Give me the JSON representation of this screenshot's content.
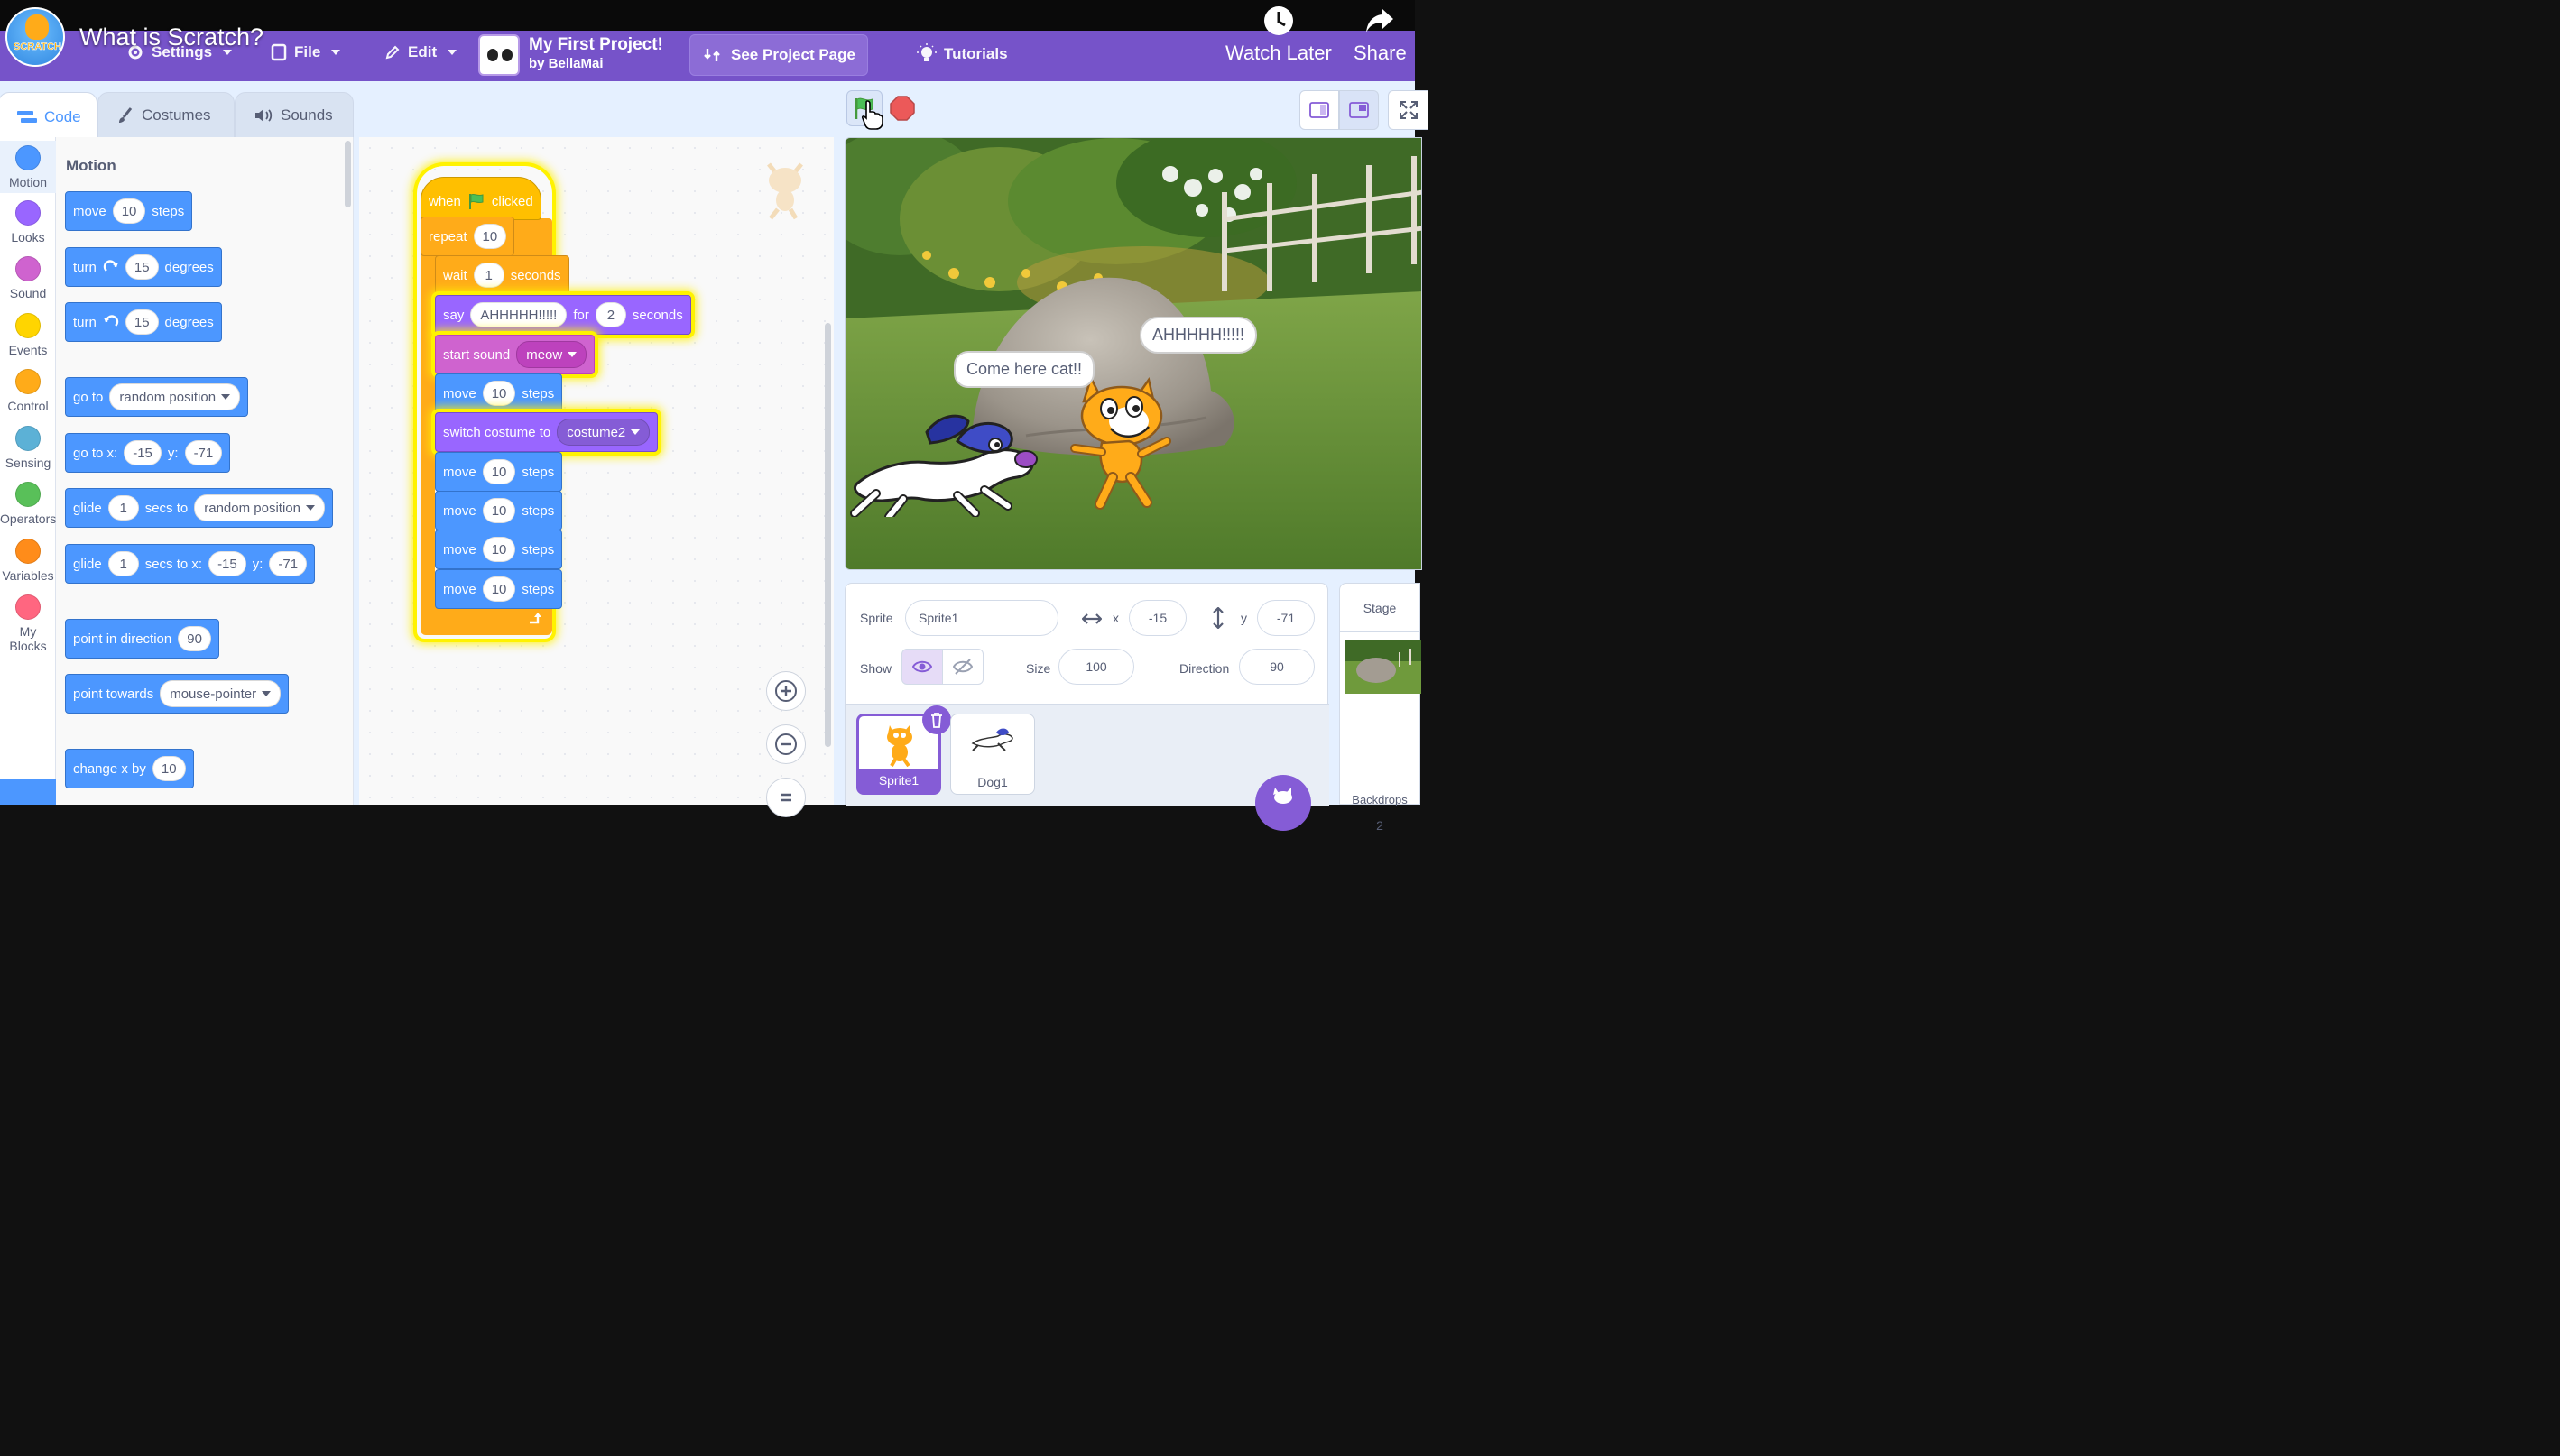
{
  "video": {
    "title": "What is Scratch?",
    "watch_later": "Watch Later",
    "share": "Share"
  },
  "menu": {
    "logo_text": "SCRATCH",
    "settings": "Settings",
    "file": "File",
    "edit": "Edit",
    "project_title": "My First Project!",
    "project_by": "by BellaMai",
    "see_project": "See Project Page",
    "tutorials": "Tutorials"
  },
  "tabs": {
    "code": "Code",
    "costumes": "Costumes",
    "sounds": "Sounds"
  },
  "categories": [
    {
      "label": "Motion",
      "color": "#4c97ff"
    },
    {
      "label": "Looks",
      "color": "#9966ff"
    },
    {
      "label": "Sound",
      "color": "#cf63cf"
    },
    {
      "label": "Events",
      "color": "#ffd500"
    },
    {
      "label": "Control",
      "color": "#ffab19"
    },
    {
      "label": "Sensing",
      "color": "#5cb1d6"
    },
    {
      "label": "Operators",
      "color": "#59c059"
    },
    {
      "label": "Variables",
      "color": "#ff8c1a"
    },
    {
      "label": "My Blocks",
      "color": "#ff6680"
    }
  ],
  "palette": {
    "title": "Motion",
    "move": {
      "a": "move",
      "n": "10",
      "b": "steps"
    },
    "turn_right": {
      "a": "turn",
      "n": "15",
      "b": "degrees"
    },
    "turn_left": {
      "a": "turn",
      "n": "15",
      "b": "degrees"
    },
    "go_to": {
      "a": "go to",
      "dd": "random position"
    },
    "go_to_xy": {
      "a": "go to x:",
      "x": "-15",
      "b": "y:",
      "y": "-71"
    },
    "glide_to": {
      "a": "glide",
      "n": "1",
      "b": "secs to",
      "dd": "random position"
    },
    "glide_xy": {
      "a": "glide",
      "n": "1",
      "b": "secs to x:",
      "x": "-15",
      "c": "y:",
      "y": "-71"
    },
    "point_dir": {
      "a": "point in direction",
      "n": "90"
    },
    "point_towards": {
      "a": "point towards",
      "dd": "mouse-pointer"
    },
    "change_x": {
      "a": "change x by",
      "n": "10"
    }
  },
  "script": {
    "hat": {
      "a": "when",
      "b": "clicked"
    },
    "repeat": {
      "a": "repeat",
      "n": "10"
    },
    "wait": {
      "a": "wait",
      "n": "1",
      "b": "seconds"
    },
    "say": {
      "a": "say",
      "t": "AHHHHH!!!!!",
      "b": "for",
      "n": "2",
      "c": "seconds"
    },
    "sound": {
      "a": "start sound",
      "dd": "meow"
    },
    "move1": {
      "a": "move",
      "n": "10",
      "b": "steps"
    },
    "costume": {
      "a": "switch costume to",
      "dd": "costume2"
    },
    "move2": {
      "a": "move",
      "n": "10",
      "b": "steps"
    },
    "move3": {
      "a": "move",
      "n": "10",
      "b": "steps"
    },
    "move4": {
      "a": "move",
      "n": "10",
      "b": "steps"
    },
    "move5": {
      "a": "move",
      "n": "10",
      "b": "steps"
    }
  },
  "stage": {
    "bubble_dog": "Come here cat!!",
    "bubble_cat": "AHHHHH!!!!!"
  },
  "sprite_info": {
    "sprite_label": "Sprite",
    "sprite_name": "Sprite1",
    "x_label": "x",
    "x": "-15",
    "y_label": "y",
    "y": "-71",
    "show_label": "Show",
    "size_label": "Size",
    "size": "100",
    "direction_label": "Direction",
    "direction": "90"
  },
  "sprites": [
    {
      "name": "Sprite1"
    },
    {
      "name": "Dog1"
    }
  ],
  "stage_panel": {
    "title": "Stage",
    "backdrops_label": "Backdrops",
    "backdrops_count": "2"
  }
}
